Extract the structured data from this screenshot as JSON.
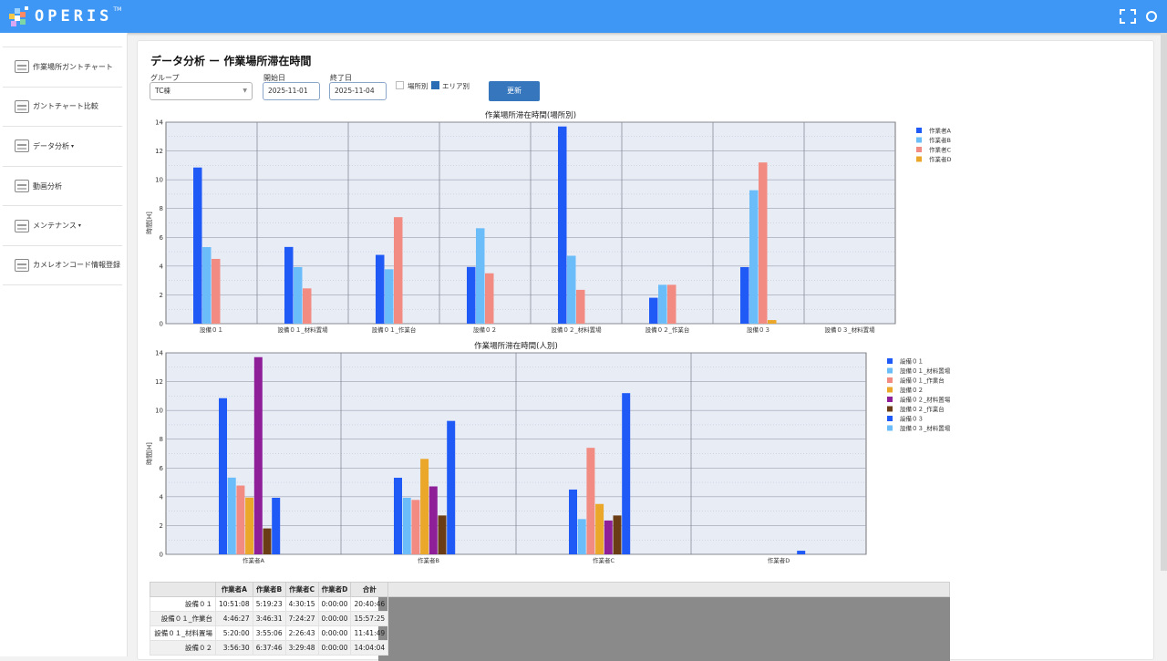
{
  "app": {
    "logo_text": "OPERIS",
    "logo_tm": "TM"
  },
  "sidebar": {
    "items": [
      {
        "label": "作業場所ガントチャート",
        "icon": "gantt-chart-icon",
        "caret": ""
      },
      {
        "label": "ガントチャート比較",
        "icon": "compare-chart-icon",
        "caret": ""
      },
      {
        "label": "データ分析",
        "icon": "data-analysis-icon",
        "caret": "▾"
      },
      {
        "label": "動画分析",
        "icon": "video-search-icon",
        "caret": ""
      },
      {
        "label": "メンテナンス",
        "icon": "maintenance-icon",
        "caret": "▾"
      },
      {
        "label": "カメレオンコード情報登録",
        "icon": "code-register-icon",
        "caret": ""
      }
    ]
  },
  "page": {
    "title": "データ分析 ー 作業場所滞在時間"
  },
  "filters": {
    "group_label": "グループ",
    "group_value": "TC棟",
    "start_label": "開始日",
    "start_value": "2025-11-01",
    "end_label": "終了日",
    "end_value": "2025-11-04",
    "by_place_label": "場所別",
    "by_place_checked": false,
    "by_area_label": "エリア別",
    "by_area_checked": true,
    "update_label": "更新"
  },
  "colors": {
    "a": "#1f5af7",
    "b": "#6bbdfa",
    "c": "#f28b82",
    "d": "#eaa729",
    "purple": "#8e1f99",
    "brown": "#6b3d16",
    "plot_bg": "#e8ecf5"
  },
  "chart_data": [
    {
      "type": "bar",
      "title": "作業場所滞在時間(場所別)",
      "ylabel": "時間[H]",
      "ylim": [
        0,
        14
      ],
      "yticks": [
        0,
        2,
        4,
        6,
        8,
        10,
        12,
        14
      ],
      "categories": [
        "設備０１",
        "設備０１_材料置場",
        "設備０１_作業台",
        "設備０２",
        "設備０２_材料置場",
        "設備０２_作業台",
        "設備０３",
        "設備０３_材料置場"
      ],
      "series": [
        {
          "name": "作業者A",
          "color": "#1f5af7",
          "values": [
            10.85,
            5.33,
            4.78,
            3.94,
            13.7,
            1.8,
            3.93,
            0
          ]
        },
        {
          "name": "作業者B",
          "color": "#6bbdfa",
          "values": [
            5.32,
            3.93,
            3.78,
            6.63,
            4.72,
            2.7,
            9.27,
            0
          ]
        },
        {
          "name": "作業者C",
          "color": "#f28b82",
          "values": [
            4.5,
            2.45,
            7.4,
            3.5,
            2.35,
            2.7,
            11.2,
            0
          ]
        },
        {
          "name": "作業者D",
          "color": "#eaa729",
          "values": [
            0,
            0,
            0,
            0,
            0,
            0,
            0.25,
            0
          ]
        }
      ]
    },
    {
      "type": "bar",
      "title": "作業場所滞在時間(人別)",
      "ylabel": "時間[H]",
      "ylim": [
        0,
        14
      ],
      "yticks": [
        0,
        2,
        4,
        6,
        8,
        10,
        12,
        14
      ],
      "categories": [
        "作業者A",
        "作業者B",
        "作業者C",
        "作業者D"
      ],
      "series": [
        {
          "name": "設備０１",
          "color": "#1f5af7",
          "values": [
            10.85,
            5.32,
            4.5,
            0
          ]
        },
        {
          "name": "設備０１_材料置場",
          "color": "#6bbdfa",
          "values": [
            5.33,
            3.93,
            2.45,
            0
          ]
        },
        {
          "name": "設備０１_作業台",
          "color": "#f28b82",
          "values": [
            4.78,
            3.78,
            7.4,
            0
          ]
        },
        {
          "name": "設備０２",
          "color": "#eaa729",
          "values": [
            3.94,
            6.63,
            3.5,
            0
          ]
        },
        {
          "name": "設備０２_材料置場",
          "color": "#8e1f99",
          "values": [
            13.7,
            4.72,
            2.35,
            0
          ]
        },
        {
          "name": "設備０２_作業台",
          "color": "#6b3d16",
          "values": [
            1.8,
            2.7,
            2.7,
            0
          ]
        },
        {
          "name": "設備０３",
          "color": "#1f5af7",
          "values": [
            3.93,
            9.27,
            11.2,
            0.25
          ]
        },
        {
          "name": "設備０３_材料置場",
          "color": "#6bbdfa",
          "values": [
            0,
            0,
            0,
            0
          ]
        }
      ]
    }
  ],
  "table": {
    "headers": [
      "",
      "作業者A",
      "作業者B",
      "作業者C",
      "作業者D",
      "合計"
    ],
    "rows": [
      [
        "設備０１",
        "10:51:08",
        "5:19:23",
        "4:30:15",
        "0:00:00",
        "20:40:46"
      ],
      [
        "設備０１_作業台",
        "4:46:27",
        "3:46:31",
        "7:24:27",
        "0:00:00",
        "15:57:25"
      ],
      [
        "設備０１_材料置場",
        "5:20:00",
        "3:55:06",
        "2:26:43",
        "0:00:00",
        "11:41:49"
      ],
      [
        "設備０２",
        "3:56:30",
        "6:37:46",
        "3:29:48",
        "0:00:00",
        "14:04:04"
      ]
    ]
  }
}
